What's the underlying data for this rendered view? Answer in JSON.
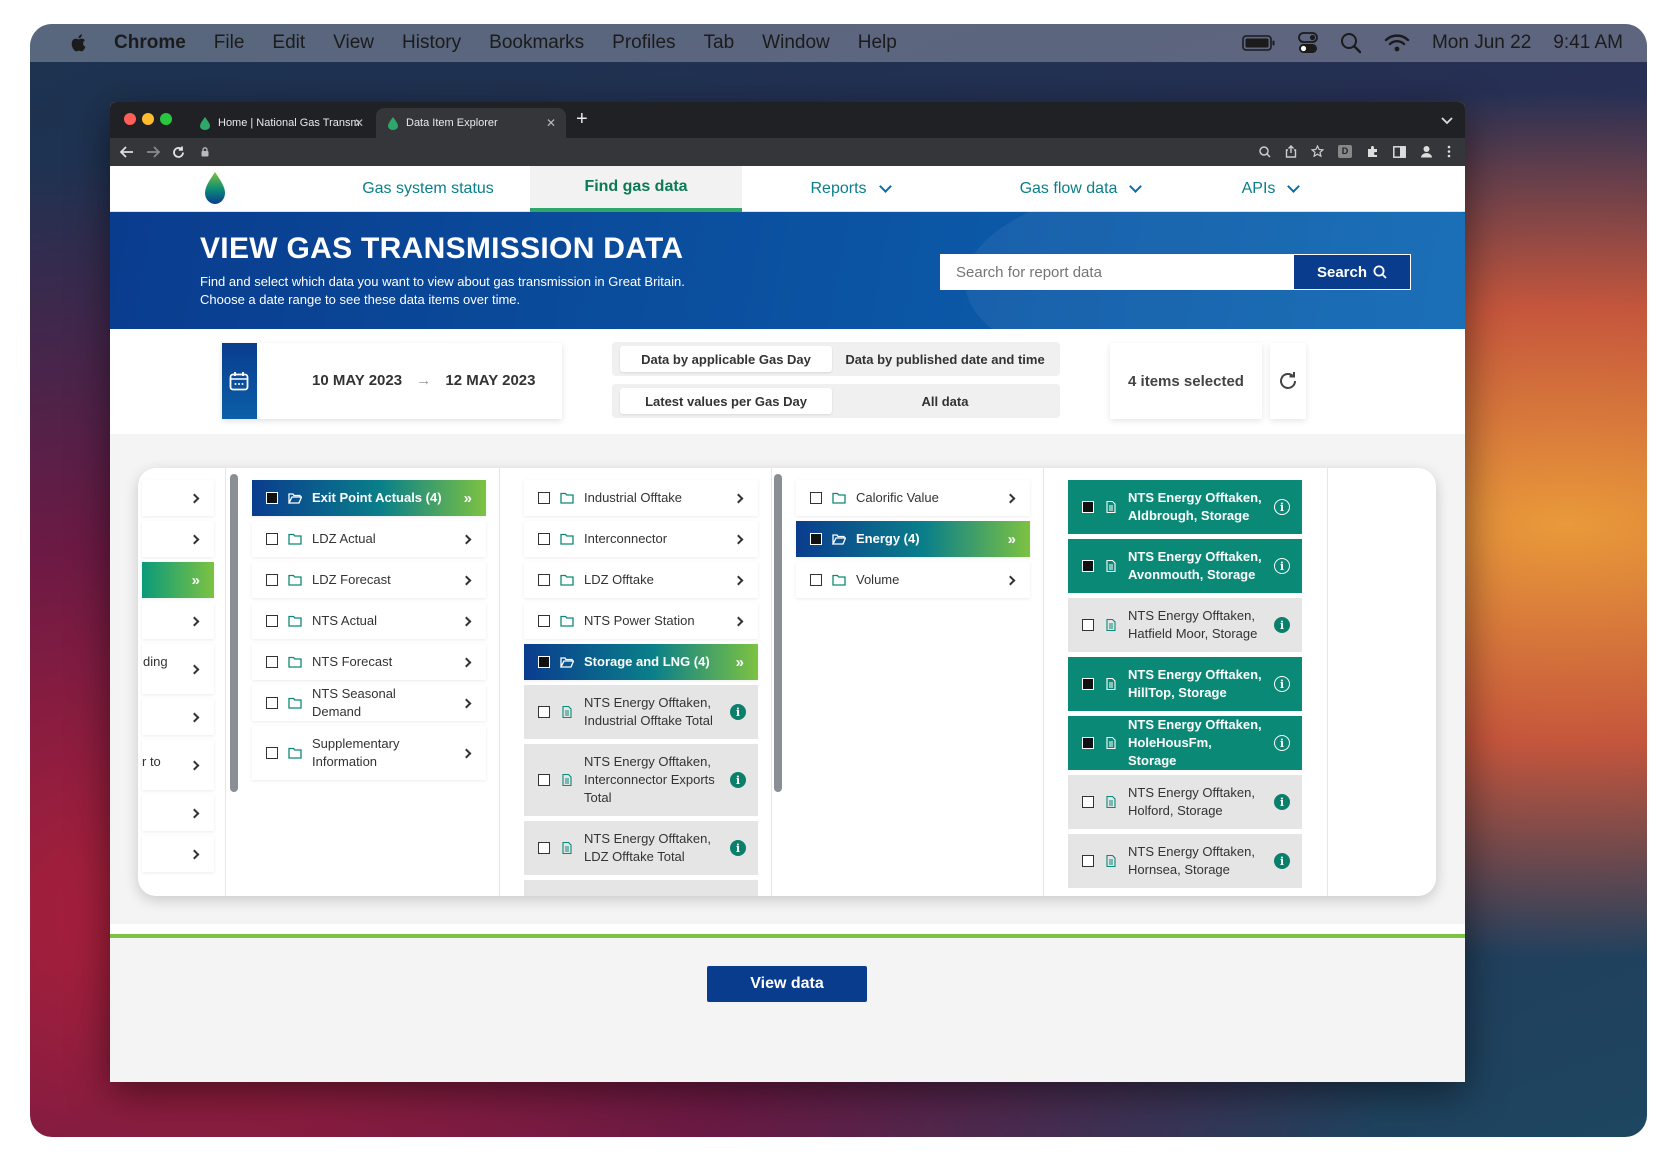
{
  "menubar": {
    "app": "Chrome",
    "items": [
      "File",
      "Edit",
      "View",
      "History",
      "Bookmarks",
      "Profiles",
      "Tab",
      "Window",
      "Help"
    ],
    "date": "Mon Jun 22",
    "time": "9:41 AM"
  },
  "browser": {
    "tabs": [
      {
        "title": "Home | National Gas Transmiss"
      },
      {
        "title": "Data Item Explorer"
      }
    ]
  },
  "nav": {
    "items": [
      "Gas system status",
      "Find gas data",
      "Reports",
      "Gas flow data",
      "APIs"
    ]
  },
  "hero": {
    "title": "VIEW GAS TRANSMISSION DATA",
    "line1": "Find and select which data you want to view about gas transmission in Great Britain.",
    "line2": "Choose a date range to see these data items over time.",
    "search_placeholder": "Search for report data",
    "search_label": "Search"
  },
  "filters": {
    "date_from": "10 MAY 2023",
    "date_arrow": "→",
    "date_to": "12 MAY 2023",
    "toggle1": [
      "Data by applicable Gas Day",
      "Data by published date and time"
    ],
    "toggle2": [
      "Latest values per Gas Day",
      "All data"
    ],
    "selected_count": "4 items selected"
  },
  "explorer": {
    "col0": [
      "ding",
      "r to"
    ],
    "col1": [
      "Exit Point Actuals (4)",
      "LDZ Actual",
      "LDZ Forecast",
      "NTS Actual",
      "NTS Forecast",
      "NTS Seasonal Demand",
      "Supplementary Information"
    ],
    "col2": [
      "Industrial Offtake",
      "Interconnector",
      "LDZ Offtake",
      "NTS Power Station",
      "Storage and LNG (4)",
      "NTS Energy Offtaken, Industrial Offtake Total",
      "NTS Energy Offtaken, Interconnector Exports Total",
      "NTS Energy Offtaken, LDZ Offtake Total"
    ],
    "col3": [
      "Calorific Value",
      "Energy (4)",
      "Volume"
    ],
    "col4": [
      "NTS Energy Offtaken, Aldbrough, Storage",
      "NTS Energy Offtaken, Avonmouth, Storage",
      "NTS Energy Offtaken, Hatfield Moor, Storage",
      "NTS Energy Offtaken, HillTop, Storage",
      "NTS Energy Offtaken, HoleHousFm, Storage",
      "NTS Energy Offtaken, Holford, Storage",
      "NTS Energy Offtaken, Hornsea, Storage"
    ]
  },
  "footer": {
    "button": "View data"
  },
  "colors": {
    "navy": "#0a3c8e",
    "teal": "#0a8a76",
    "green": "#7dc242"
  }
}
